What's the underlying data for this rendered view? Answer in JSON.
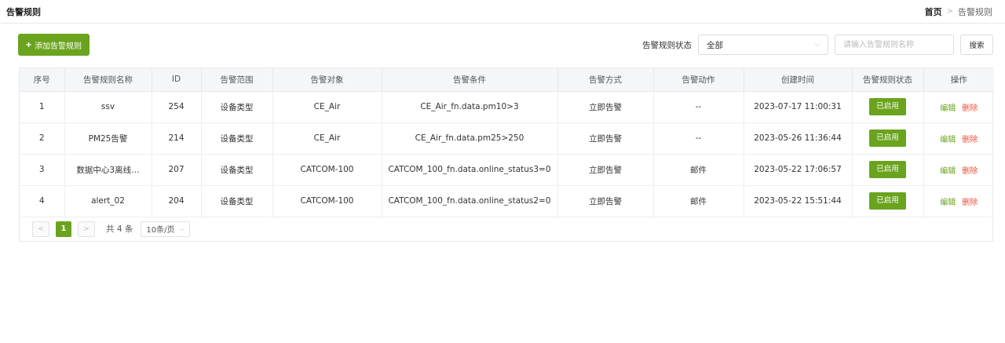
{
  "header": {
    "title": "告警规则",
    "breadcrumb_home": "首页",
    "breadcrumb_sep": ">",
    "breadcrumb_current": "告警规则"
  },
  "toolbar": {
    "add_label": "添加告警规则",
    "status_label": "告警规则状态",
    "status_value": "全部",
    "search_placeholder": "请输入告警规则名称",
    "search_label": "搜索"
  },
  "table": {
    "columns": [
      "序号",
      "告警规则名称",
      "ID",
      "告警范围",
      "告警对象",
      "告警条件",
      "告警方式",
      "告警动作",
      "创建时间",
      "告警规则状态",
      "操作"
    ],
    "rows": [
      {
        "idx": "1",
        "name": "ssv",
        "id": "254",
        "scope": "设备类型",
        "target": "CE_Air",
        "condition": "CE_Air_fn.data.pm10>3",
        "method": "立即告警",
        "action": "--",
        "created": "2023-07-17 11:00:31",
        "status": "已启用",
        "edit": "编辑",
        "delete": "删除"
      },
      {
        "idx": "2",
        "name": "PM25告警",
        "id": "214",
        "scope": "设备类型",
        "target": "CE_Air",
        "condition": "CE_Air_fn.data.pm25>250",
        "method": "立即告警",
        "action": "--",
        "created": "2023-05-26 11:36:44",
        "status": "已启用",
        "edit": "编辑",
        "delete": "删除"
      },
      {
        "idx": "3",
        "name": "数据中心3离线…",
        "id": "207",
        "scope": "设备类型",
        "target": "CATCOM-100",
        "condition": "CATCOM_100_fn.data.online_status3=0",
        "method": "立即告警",
        "action": "邮件",
        "created": "2023-05-22 17:06:57",
        "status": "已启用",
        "edit": "编辑",
        "delete": "删除"
      },
      {
        "idx": "4",
        "name": "alert_02",
        "id": "204",
        "scope": "设备类型",
        "target": "CATCOM-100",
        "condition": "CATCOM_100_fn.data.online_status2=0",
        "method": "立即告警",
        "action": "邮件",
        "created": "2023-05-22 15:51:44",
        "status": "已启用",
        "edit": "编辑",
        "delete": "删除"
      }
    ]
  },
  "pager": {
    "current_page": "1",
    "total_text": "共 4 条",
    "page_size": "10条/页"
  },
  "colors": {
    "accent": "#6aa31e",
    "danger": "#e8503a"
  }
}
